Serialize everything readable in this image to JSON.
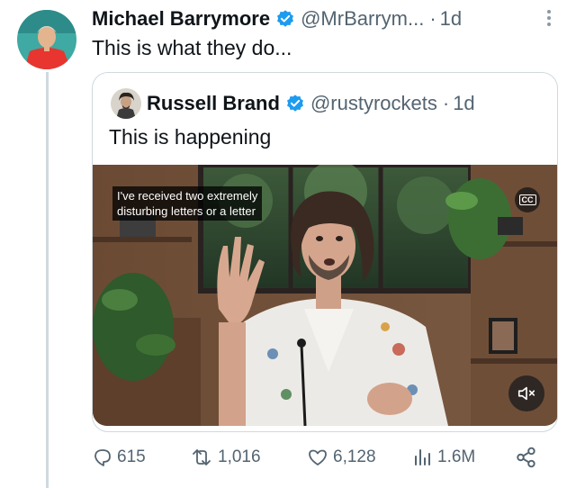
{
  "tweet": {
    "author_name": "Michael Barrymore",
    "author_handle": "@MrBarrym...",
    "time": "1d",
    "separator": "·",
    "text": "This is what they do..."
  },
  "quoted": {
    "author_name": "Russell Brand",
    "author_handle": "@rustyrockets",
    "time": "1d",
    "separator": "·",
    "text": "This is happening",
    "video": {
      "caption_line1": "I've received two extremely",
      "caption_line2": "disturbing letters or a letter",
      "cc_label": "CC"
    }
  },
  "actions": {
    "replies": "615",
    "reposts": "1,016",
    "likes": "6,128",
    "views": "1.6M"
  },
  "colors": {
    "text": "#0f1419",
    "muted": "#536471",
    "verified": "#1d9bf0",
    "border": "#cfd9de"
  },
  "icons": [
    "verified-badge-icon",
    "more-options-icon",
    "closed-captions-icon",
    "volume-muted-icon",
    "reply-icon",
    "repost-icon",
    "like-icon",
    "views-icon",
    "share-icon"
  ]
}
